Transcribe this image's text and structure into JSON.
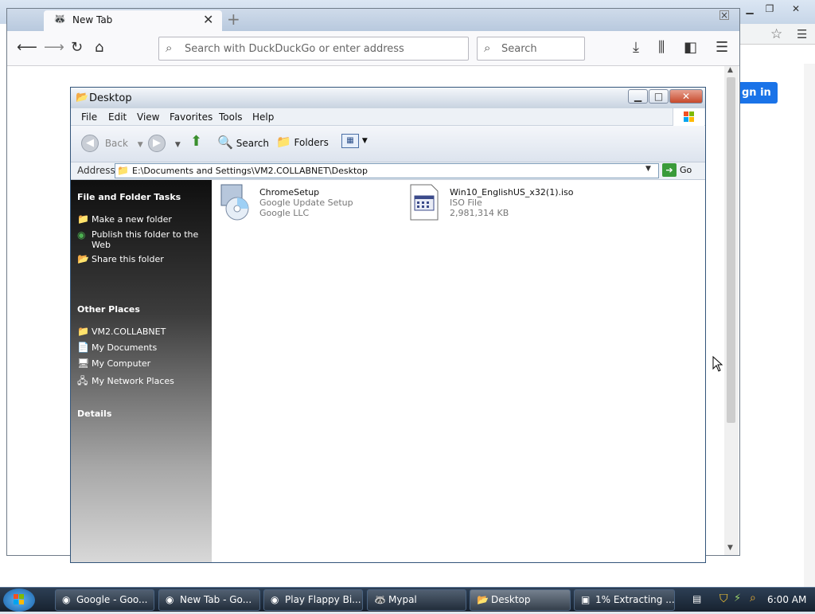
{
  "firefox": {
    "tab_title": "New Tab",
    "url_placeholder": "Search with DuckDuckGo or enter address",
    "search_placeholder": "Search"
  },
  "chrome_bg": {
    "signin_label": "gn in"
  },
  "explorer": {
    "title": "Desktop",
    "menu": [
      "File",
      "Edit",
      "View",
      "Favorites",
      "Tools",
      "Help"
    ],
    "toolbar": {
      "back": "Back",
      "search": "Search",
      "folders": "Folders"
    },
    "address_label": "Address",
    "address_value": "E:\\Documents and Settings\\VM2.COLLABNET\\Desktop",
    "go_label": "Go",
    "sidebar": {
      "file_tasks_title": "File and Folder Tasks",
      "file_tasks": [
        "Make a new folder",
        "Publish this folder to the Web",
        "Share this folder"
      ],
      "other_places_title": "Other Places",
      "other_places": [
        "VM2.COLLABNET",
        "My Documents",
        "My Computer",
        "My Network Places"
      ],
      "details_title": "Details"
    },
    "files": [
      {
        "name": "ChromeSetup",
        "line2": "Google Update Setup",
        "line3": "Google LLC"
      },
      {
        "name": "Win10_EnglishUS_x32(1).iso",
        "line2": "ISO File",
        "line3": "2,981,314 KB"
      }
    ]
  },
  "taskbar": {
    "items": [
      "Google - Goo...",
      "New Tab - Go...",
      "Play Flappy Bi...",
      "Mypal",
      "Desktop",
      "1% Extracting ..."
    ],
    "clock": "6:00 AM"
  }
}
